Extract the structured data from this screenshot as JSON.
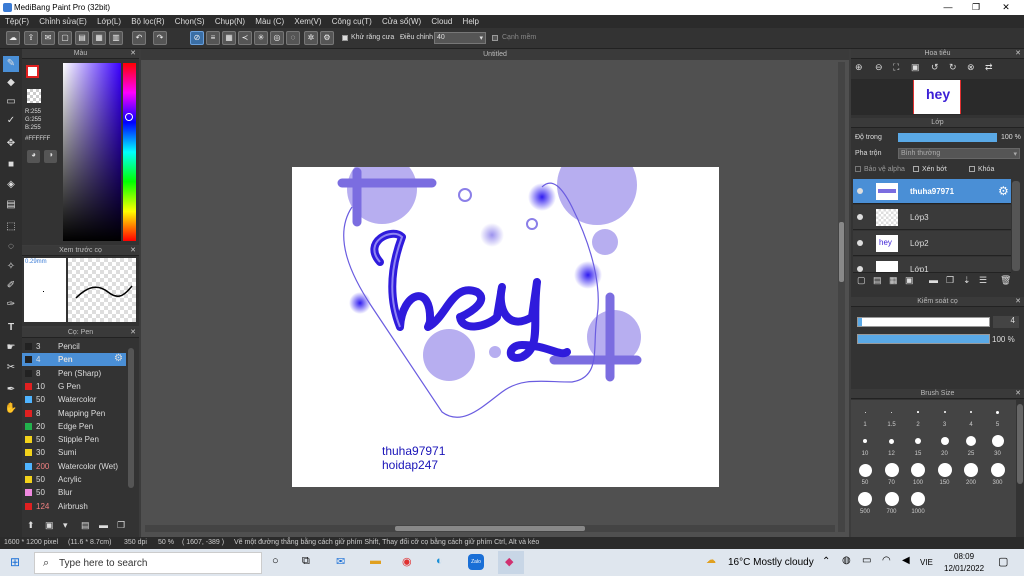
{
  "window": {
    "title": "MediBang Paint Pro (32bit)"
  },
  "menu": [
    "Tệp(F)",
    "Chỉnh sửa(E)",
    "Lớp(L)",
    "Bộ lọc(R)",
    "Chọn(S)",
    "Chụp(N)",
    "Màu (C)",
    "Xem(V)",
    "Công cụ(T)",
    "Cửa sổ(W)",
    "Cloud",
    "Help"
  ],
  "toolbar": {
    "antialias": "Khử răng cưa",
    "adjust": "Điều chỉnh",
    "adjust_value": "40",
    "edge": "Cạnh mềm"
  },
  "color_panel": {
    "title": "Màu",
    "r": "R:255",
    "g": "G:255",
    "b": "B:255",
    "hex": "#FFFFFF"
  },
  "brush_preview": {
    "title": "Xem trước cọ",
    "size": "0.29mm"
  },
  "brush_panel": {
    "title": "Cọ: Pen",
    "items": [
      {
        "size": "3",
        "name": "Pencil",
        "color": "#222222"
      },
      {
        "size": "4",
        "name": "Pen",
        "color": "#222222"
      },
      {
        "size": "8",
        "name": "Pen (Sharp)",
        "color": "#222222"
      },
      {
        "size": "10",
        "name": "G Pen",
        "color": "#e02020"
      },
      {
        "size": "50",
        "name": "Watercolor",
        "color": "#4fb4ff"
      },
      {
        "size": "8",
        "name": "Mapping Pen",
        "color": "#e02020"
      },
      {
        "size": "20",
        "name": "Edge Pen",
        "color": "#22b14c"
      },
      {
        "size": "50",
        "name": "Stipple Pen",
        "color": "#f2d21b"
      },
      {
        "size": "30",
        "name": "Sumi",
        "color": "#f2d21b"
      },
      {
        "size": "200",
        "name": "Watercolor (Wet)",
        "color": "#4fb4ff"
      },
      {
        "size": "50",
        "name": "Acrylic",
        "color": "#f2d21b"
      },
      {
        "size": "50",
        "name": "Blur",
        "color": "#f08ae0"
      },
      {
        "size": "124",
        "name": "Airbrush",
        "color": "#e02020"
      }
    ]
  },
  "canvas": {
    "tab": "Untitled",
    "text_line1": "thuha97971",
    "text_line2": "hoidap247",
    "art_text": "hey"
  },
  "navigator": {
    "title": "Hoa tiêu"
  },
  "layers": {
    "title": "Lớp",
    "opacity_label": "Độ trong",
    "opacity_value": "100 %",
    "blend_label": "Pha trộn",
    "blend_value": "Bình thường",
    "protect_alpha": "Bảo vệ alpha",
    "clip": "Xén bớt",
    "lock": "Khóa",
    "items": [
      "thuha97971",
      "Lớp3",
      "Lớp2",
      "Lớp1"
    ]
  },
  "brush_control": {
    "title": "Kiểm soát cọ",
    "size_value": "4",
    "opacity_value": "100 %",
    "opacity_fill": 1.0
  },
  "brush_size": {
    "title": "Brush Size",
    "sizes": [
      "1",
      "1.5",
      "2",
      "3",
      "4",
      "5",
      "10",
      "12",
      "15",
      "20",
      "25",
      "30",
      "50",
      "70",
      "100",
      "150",
      "200",
      "300",
      "500",
      "700",
      "1000"
    ]
  },
  "status": {
    "dims": "1600 * 1200 pixel",
    "physical": "(11.6 * 8.7cm)",
    "dpi": "350 dpi",
    "zoom": "50 %",
    "coords": "( 1607, -389 )",
    "hint": "Vẽ một đường thẳng bằng cách giữ phím Shift, Thay đổi cỡ cọ bằng cách giữ phím Ctrl, Alt và kéo"
  },
  "taskbar": {
    "search": "Type here to search",
    "weather": "16°C  Mostly cloudy",
    "lang": "VIE",
    "time": "08:09",
    "date": "12/01/2022"
  },
  "colors": {
    "accent": "#4a8fd6",
    "purple": "#3b1fd6",
    "lavender": "#b7aef0"
  }
}
